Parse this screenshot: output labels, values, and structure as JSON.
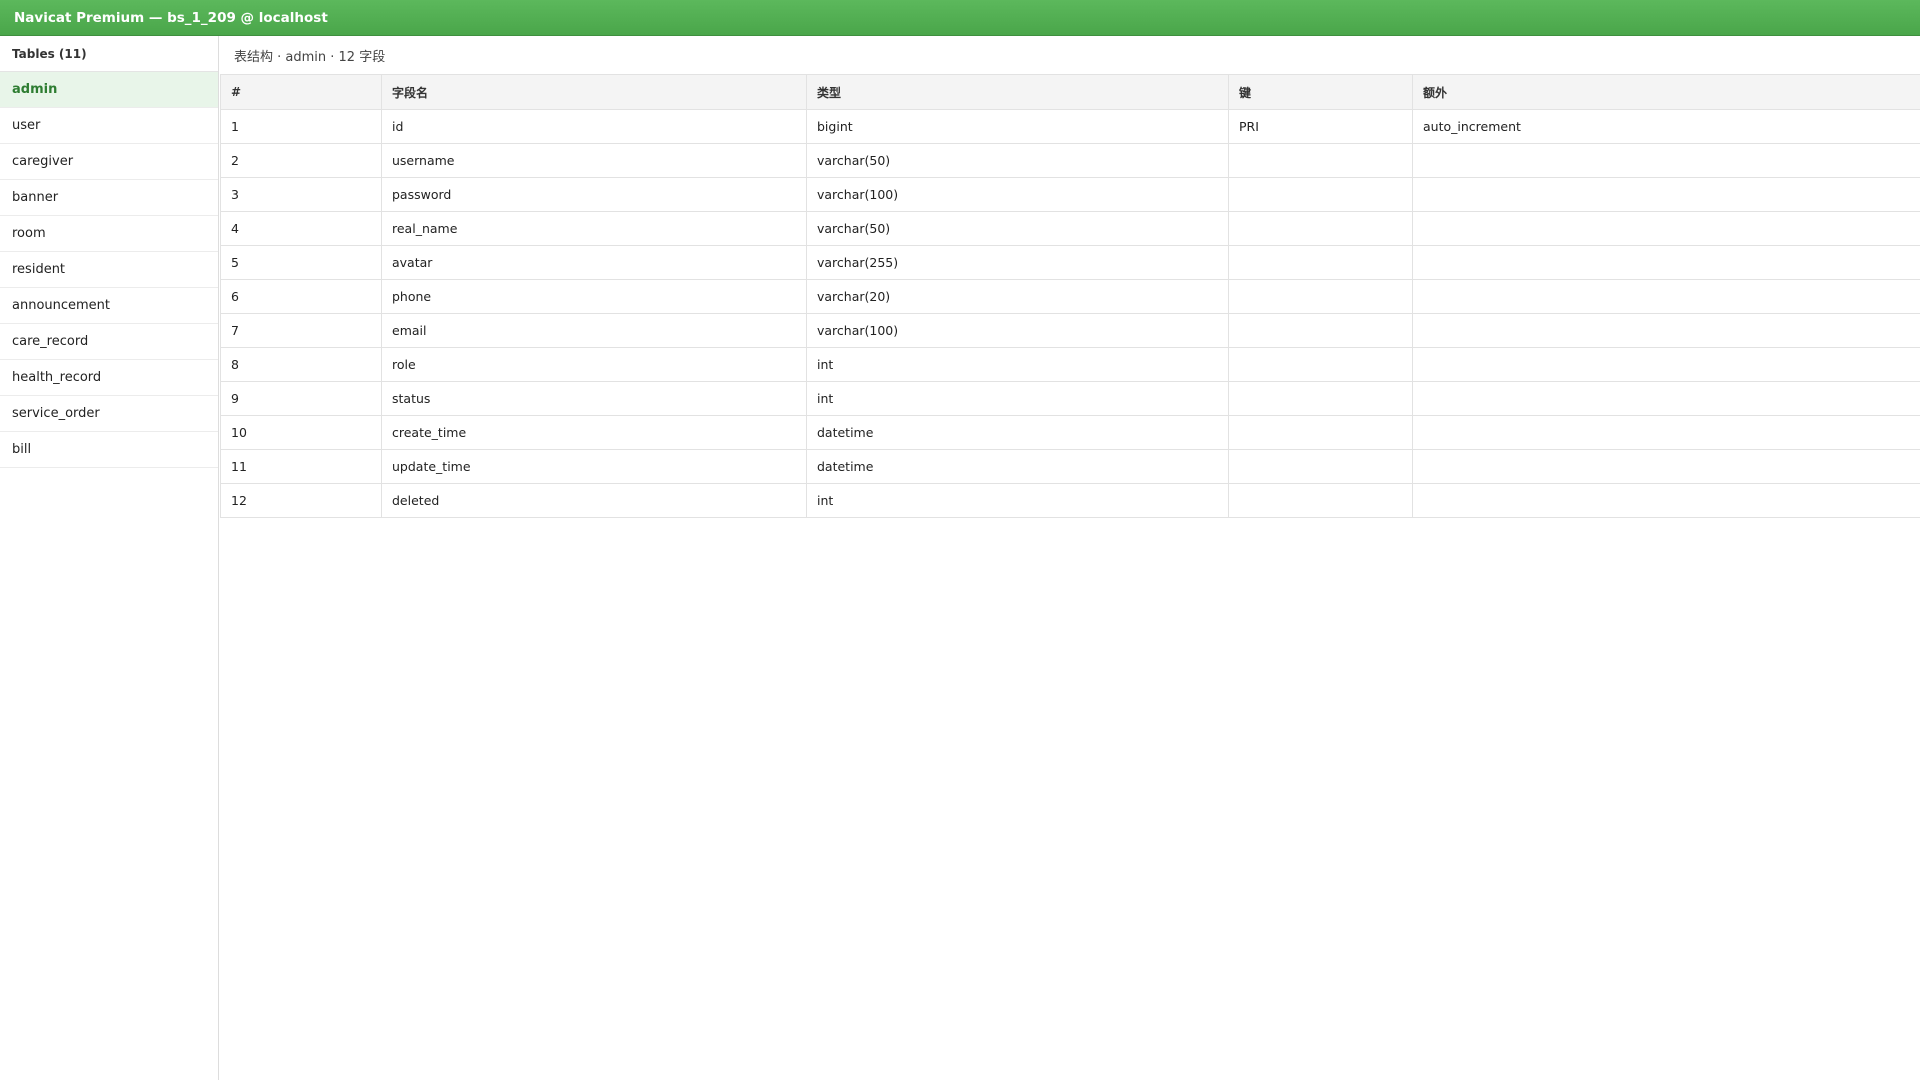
{
  "window": {
    "title": "Navicat Premium — bs_1_209 @ localhost"
  },
  "sidebar": {
    "header": "Tables (11)",
    "items": [
      {
        "label": "admin"
      },
      {
        "label": "user"
      },
      {
        "label": "caregiver"
      },
      {
        "label": "banner"
      },
      {
        "label": "room"
      },
      {
        "label": "resident"
      },
      {
        "label": "announcement"
      },
      {
        "label": "care_record"
      },
      {
        "label": "health_record"
      },
      {
        "label": "service_order"
      },
      {
        "label": "bill"
      }
    ],
    "active_index": 0
  },
  "main": {
    "structure_title": "表结构 · admin · 12 字段",
    "columns": [
      "#",
      "字段名",
      "类型",
      "键",
      "额外"
    ],
    "rows": [
      {
        "num": "1",
        "name": "id",
        "type": "bigint",
        "key": "PRI",
        "extra": "auto_increment"
      },
      {
        "num": "2",
        "name": "username",
        "type": "varchar(50)",
        "key": "",
        "extra": ""
      },
      {
        "num": "3",
        "name": "password",
        "type": "varchar(100)",
        "key": "",
        "extra": ""
      },
      {
        "num": "4",
        "name": "real_name",
        "type": "varchar(50)",
        "key": "",
        "extra": ""
      },
      {
        "num": "5",
        "name": "avatar",
        "type": "varchar(255)",
        "key": "",
        "extra": ""
      },
      {
        "num": "6",
        "name": "phone",
        "type": "varchar(20)",
        "key": "",
        "extra": ""
      },
      {
        "num": "7",
        "name": "email",
        "type": "varchar(100)",
        "key": "",
        "extra": ""
      },
      {
        "num": "8",
        "name": "role",
        "type": "int",
        "key": "",
        "extra": ""
      },
      {
        "num": "9",
        "name": "status",
        "type": "int",
        "key": "",
        "extra": ""
      },
      {
        "num": "10",
        "name": "create_time",
        "type": "datetime",
        "key": "",
        "extra": ""
      },
      {
        "num": "11",
        "name": "update_time",
        "type": "datetime",
        "key": "",
        "extra": ""
      },
      {
        "num": "12",
        "name": "deleted",
        "type": "int",
        "key": "",
        "extra": ""
      }
    ]
  },
  "colors": {
    "titlebar": "#4caf50",
    "active_item_bg": "#e8f5e9",
    "active_item_text": "#2e7d32"
  }
}
